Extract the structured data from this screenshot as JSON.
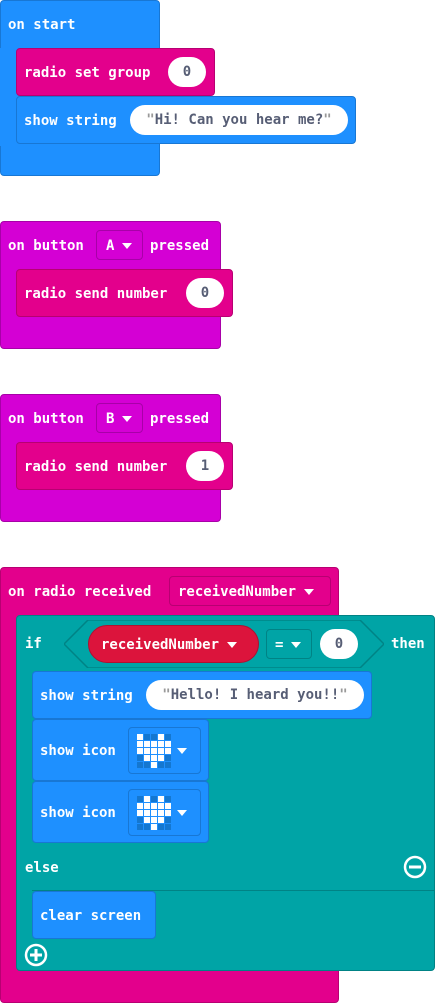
{
  "colors": {
    "basic": "#1e90ff",
    "radio": "#e3008c",
    "input": "#d400d4",
    "logic": "#00a4a6",
    "variable": "#dc143c"
  },
  "on_start": {
    "label": "on start",
    "set_group": {
      "label": "radio set group",
      "value": "0"
    },
    "show_string": {
      "label": "show string",
      "value": "Hi! Can you hear me?"
    }
  },
  "button_a": {
    "label_on": "on button",
    "button": "A",
    "label_pressed": "pressed",
    "send": {
      "label": "radio send number",
      "value": "0"
    }
  },
  "button_b": {
    "label_on": "on button",
    "button": "B",
    "label_pressed": "pressed",
    "send": {
      "label": "radio send number",
      "value": "1"
    }
  },
  "received": {
    "label": "on radio received",
    "variable": "receivedNumber",
    "if_block": {
      "if_label": "if",
      "variable": "receivedNumber",
      "operator": "=",
      "compare_value": "0",
      "then_label": "then",
      "show_string": {
        "label": "show string",
        "value": "Hello! I heard you!!"
      },
      "show_icon_1": {
        "label": "show icon",
        "icon": "heart-icon"
      },
      "show_icon_2": {
        "label": "show icon",
        "icon": "small-heart-icon"
      },
      "else_label": "else",
      "clear_screen": {
        "label": "clear screen"
      }
    }
  }
}
